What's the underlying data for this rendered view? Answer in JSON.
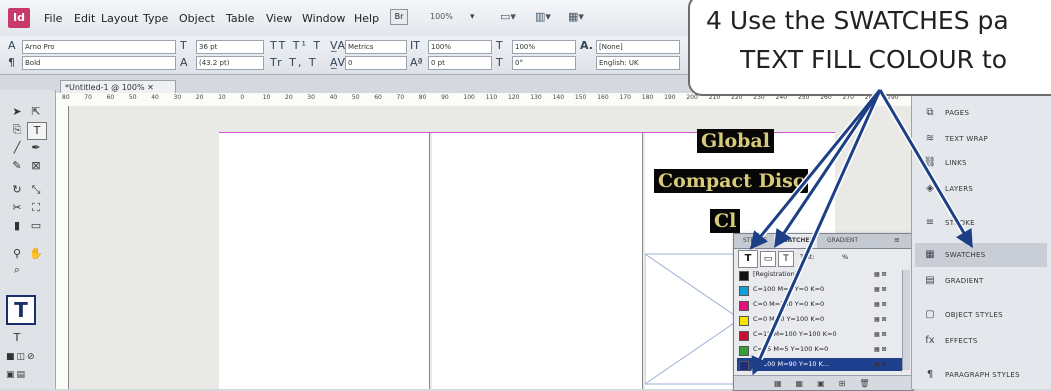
{
  "app": {
    "logo": "Id"
  },
  "menubar": {
    "items": [
      "File",
      "Edit",
      "Layout",
      "Type",
      "Object",
      "Table",
      "View",
      "Window",
      "Help"
    ],
    "zoom": "100%"
  },
  "controlbar": {
    "font_family": "Arno Pro",
    "font_style": "Bold",
    "font_size": "36 pt",
    "leading": "(43.2 pt)",
    "kerning": "Metrics",
    "tracking": "0",
    "vscale": "100%",
    "hscale": "100%",
    "baseline": "0 pt",
    "skew": "0°",
    "char_style": "[None]",
    "language": "English: UK"
  },
  "document": {
    "tab_label": "*Untitled-1 @ 100%"
  },
  "ruler": {
    "ticks": [
      "80",
      "70",
      "60",
      "50",
      "40",
      "30",
      "20",
      "10",
      "0",
      "10",
      "20",
      "30",
      "40",
      "50",
      "60",
      "70",
      "80",
      "90",
      "100",
      "110",
      "120",
      "130",
      "140",
      "150",
      "160",
      "170",
      "180",
      "190",
      "200",
      "210",
      "220",
      "230",
      "240",
      "250",
      "260",
      "270",
      "280",
      "290"
    ]
  },
  "canvas": {
    "text_line1": "Global",
    "text_line2": "Compact Disc",
    "text_line3": "Cl"
  },
  "swatches": {
    "tabs": [
      "STROKE",
      "SWATCHES",
      "GRADIENT"
    ],
    "tint_label": "Tint:",
    "tint_value": "%",
    "rows": [
      {
        "name": "[Registration]",
        "color": "#111111"
      },
      {
        "name": "C=100 M=0 Y=0 K=0",
        "color": "#12a0dc"
      },
      {
        "name": "C=0 M=100 Y=0 K=0",
        "color": "#e0107a"
      },
      {
        "name": "C=0 M=0 Y=100 K=0",
        "color": "#f5e400"
      },
      {
        "name": "C=15 M=100 Y=100 K=0",
        "color": "#c8102e"
      },
      {
        "name": "C=75 M=5 Y=100 K=0",
        "color": "#3c9c3a"
      },
      {
        "name": "C=100 M=90 Y=10 K...",
        "color": "#1d2d7a"
      }
    ]
  },
  "dock": {
    "items": [
      "PAGES",
      "TEXT WRAP",
      "LINKS",
      "LAYERS",
      "STROKE",
      "SWATCHES",
      "GRADIENT",
      "OBJECT STYLES",
      "EFFECTS",
      "PARAGRAPH STYLES"
    ]
  },
  "callout": {
    "line1": "4  Use the SWATCHES pa",
    "line2": "TEXT FILL COLOUR to"
  },
  "colors": {
    "accent": "#1f3f8f",
    "callout_arrow": "#1d3f86",
    "doc_text": "#d7cb7a"
  }
}
